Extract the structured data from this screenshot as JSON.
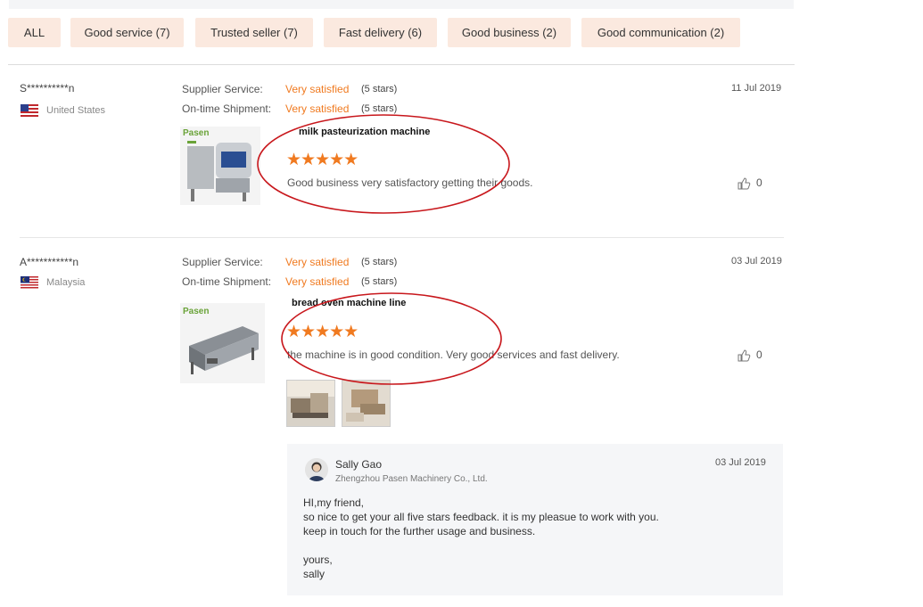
{
  "filters": [
    "ALL",
    "Good service (7)",
    "Trusted seller (7)",
    "Fast delivery (6)",
    "Good business (2)",
    "Good communication (2)"
  ],
  "reviews": [
    {
      "buyer": "S**********n",
      "country": "United States",
      "supplier_label": "Supplier Service:",
      "supplier_value": "Very satisfied",
      "supplier_stars": "(5 stars)",
      "shipment_label": "On-time Shipment:",
      "shipment_value": "Very satisfied",
      "shipment_stars": "(5 stars)",
      "date": "11 Jul 2019",
      "product": "milk pasteurization machine",
      "product_image_brand": "Pasen",
      "rating": "★★★★★",
      "comment": "Good business very satisfactory getting their goods.",
      "likes": "0"
    },
    {
      "buyer": "A***********n",
      "country": "Malaysia",
      "supplier_label": "Supplier Service:",
      "supplier_value": "Very satisfied",
      "supplier_stars": "(5 stars)",
      "shipment_label": "On-time Shipment:",
      "shipment_value": "Very satisfied",
      "shipment_stars": "(5 stars)",
      "date": "03 Jul 2019",
      "product": "bread oven machine line",
      "product_image_brand": "Pasen",
      "rating": "★★★★★",
      "comment": "the machine is in good condition. Very good services and fast delivery.",
      "likes": "0"
    }
  ],
  "reply": {
    "name": "Sally Gao",
    "company": "Zhengzhou Pasen Machinery Co., Ltd.",
    "date": "03 Jul 2019",
    "lines": [
      "HI,my friend,",
      "so nice to get your all five stars feedback. it is my pleasue to work with you.",
      "keep in touch for the further usage and business.",
      "",
      "yours,",
      "sally"
    ]
  },
  "colors": {
    "accent": "#f07a20",
    "chip_bg": "#fbe9df",
    "annotation_red": "#c8171c"
  }
}
